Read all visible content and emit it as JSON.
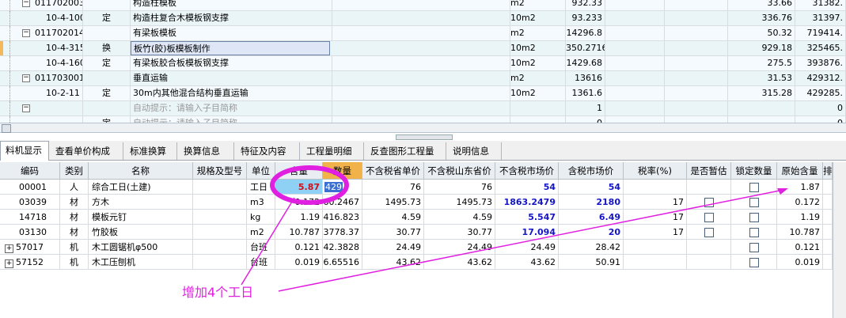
{
  "top_rows": [
    {
      "code": "011702003001",
      "tree": "minus",
      "type": "",
      "name": "构造柱模板",
      "unit": "m2",
      "qty": "932.33",
      "price": "33.66",
      "total": "31382."
    },
    {
      "code": "10-4-100",
      "tree": "",
      "type": "定",
      "name": "构造柱复合木模板钢支撑",
      "unit": "10m2",
      "qty": "93.233",
      "price": "336.76",
      "total": "31397."
    },
    {
      "code": "011702014001",
      "tree": "minus",
      "type": "",
      "name": "有梁板模板",
      "unit": "m2",
      "qty": "14296.8",
      "price": "50.32",
      "total": "719414."
    },
    {
      "code": "10-4-315",
      "tree": "",
      "type": "换",
      "name": "板竹(胶)板模板制作",
      "unit": "10m2",
      "qty": "350.2716",
      "price": "929.18",
      "total": "325465."
    },
    {
      "code": "10-4-160",
      "tree": "",
      "type": "定",
      "name": "有梁板胶合板模板钢支撑",
      "unit": "10m2",
      "qty": "1429.68",
      "price": "275.5",
      "total": "393876."
    },
    {
      "code": "011703001001",
      "tree": "minus",
      "type": "",
      "name": "垂直运输",
      "unit": "m2",
      "qty": "13616",
      "price": "31.53",
      "total": "429312."
    },
    {
      "code": "10-2-11",
      "tree": "",
      "type": "定",
      "name": "30m内其他混合结构垂直运输",
      "unit": "10m2",
      "qty": "1361.6",
      "price": "315.28",
      "total": "429285."
    },
    {
      "code": "",
      "tree": "minus",
      "type": "",
      "name": "自动提示：请输入子目简称",
      "unit": "",
      "qty": "1",
      "price": "",
      "total": "0"
    },
    {
      "code": "",
      "tree": "",
      "type": "定",
      "name": "自动提示：请输入子目简称",
      "unit": "",
      "qty": "0",
      "price": "",
      "total": "0"
    }
  ],
  "tabs": [
    "料机显示",
    "查看单价构成",
    "标准换算",
    "换算信息",
    "特征及内容",
    "工程量明细",
    "反查图形工程量",
    "说明信息"
  ],
  "headers": [
    "编码",
    "类别",
    "名称",
    "规格及型号",
    "单位",
    "含量",
    "数量",
    "不含税省单价",
    "不含税山东省价",
    "不含税市场价",
    "含税市场价",
    "税率(%)",
    "是否暂估",
    "锁定数量",
    "原始含量",
    "排"
  ],
  "rows": [
    {
      "code": "00001",
      "cat": "人",
      "name": "综合工日(土建)",
      "spec": "",
      "unit": "工日",
      "content": "5.87",
      "qty": "429",
      "p1": "76",
      "p2": "76",
      "p3": "54",
      "p4": "54",
      "tax": "",
      "est": false,
      "lock": true,
      "orig": "1.87",
      "expand": false
    },
    {
      "code": "03039",
      "cat": "材",
      "name": "方木",
      "spec": "",
      "unit": "m3",
      "content": "0.172",
      "qty": "60.2467",
      "p1": "1495.73",
      "p2": "1495.73",
      "p3": "1863.2479",
      "p4": "2180",
      "tax": "17",
      "est": true,
      "lock": true,
      "orig": "0.172",
      "expand": false
    },
    {
      "code": "14718",
      "cat": "材",
      "name": "模板元钉",
      "spec": "",
      "unit": "kg",
      "content": "1.19",
      "qty": "416.823",
      "p1": "4.59",
      "p2": "4.59",
      "p3": "5.547",
      "p4": "6.49",
      "tax": "17",
      "est": true,
      "lock": true,
      "orig": "1.19",
      "expand": false
    },
    {
      "code": "03130",
      "cat": "材",
      "name": "竹胶板",
      "spec": "",
      "unit": "m2",
      "content": "10.787",
      "qty": "3778.37",
      "p1": "30.77",
      "p2": "30.77",
      "p3": "17.094",
      "p4": "20",
      "tax": "17",
      "est": true,
      "lock": true,
      "orig": "10.787",
      "expand": false
    },
    {
      "code": "57017",
      "cat": "机",
      "name": "木工圆锯机φ500",
      "spec": "",
      "unit": "台班",
      "content": "0.121",
      "qty": "42.3828",
      "p1": "24.49",
      "p2": "24.49",
      "p3": "24.49",
      "p4": "28.42",
      "tax": "",
      "est": false,
      "lock": true,
      "orig": "0.121",
      "expand": true
    },
    {
      "code": "57152",
      "cat": "机",
      "name": "木工压刨机",
      "spec": "",
      "unit": "台班",
      "content": "0.019",
      "qty": "6.65516",
      "p1": "43.62",
      "p2": "43.62",
      "p3": "43.62",
      "p4": "50.91",
      "tax": "",
      "est": false,
      "lock": true,
      "orig": "0.019",
      "expand": true
    }
  ],
  "annotation": "增加4个工日",
  "colors": {
    "accent": "#e020e0",
    "blue_value": "#1515c8",
    "selected_row": "#dfe7f6"
  }
}
